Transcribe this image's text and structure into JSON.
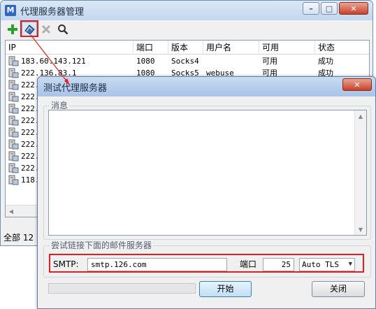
{
  "main_window": {
    "title": "代理服务器管理",
    "app_icon_glyph": "M",
    "toolbar": [
      {
        "name": "add-icon",
        "color": "#2aa02a"
      },
      {
        "name": "test-proxy-icon",
        "color": "#3d6fb5"
      },
      {
        "name": "delete-icon",
        "color": "#b0b0b0"
      },
      {
        "name": "search-icon",
        "color": "#333333"
      }
    ],
    "columns": [
      "IP",
      "端口",
      "版本",
      "用户名",
      "可用",
      "状态"
    ],
    "rows": [
      {
        "ip": "183.60.143.121",
        "port": "1080",
        "version": "Socks4",
        "user": "",
        "available": "可用",
        "status": "成功"
      },
      {
        "ip": "222.136.83.1",
        "port": "1080",
        "version": "Socks5",
        "user": "webuse",
        "available": "可用",
        "status": "成功"
      },
      {
        "ip": "222."
      },
      {
        "ip": "222."
      },
      {
        "ip": "222."
      },
      {
        "ip": "222."
      },
      {
        "ip": "222."
      },
      {
        "ip": "222."
      },
      {
        "ip": "222."
      },
      {
        "ip": "222."
      },
      {
        "ip": "118."
      }
    ],
    "status_text": "全部 12"
  },
  "dialog": {
    "title": "测试代理服务器",
    "message_group_label": "消息",
    "smtp_group_label": "尝试链接下面的邮件服务器",
    "smtp_label": "SMTP:",
    "smtp_value": "smtp.126.com",
    "port_label": "端口",
    "port_value": "25",
    "tls_value": "Auto TLS",
    "start_button": "开始",
    "close_button": "关闭"
  },
  "colors": {
    "highlight": "#e02020",
    "titlebar": "#c3d6ee",
    "window_bg": "#f0f0f0"
  }
}
